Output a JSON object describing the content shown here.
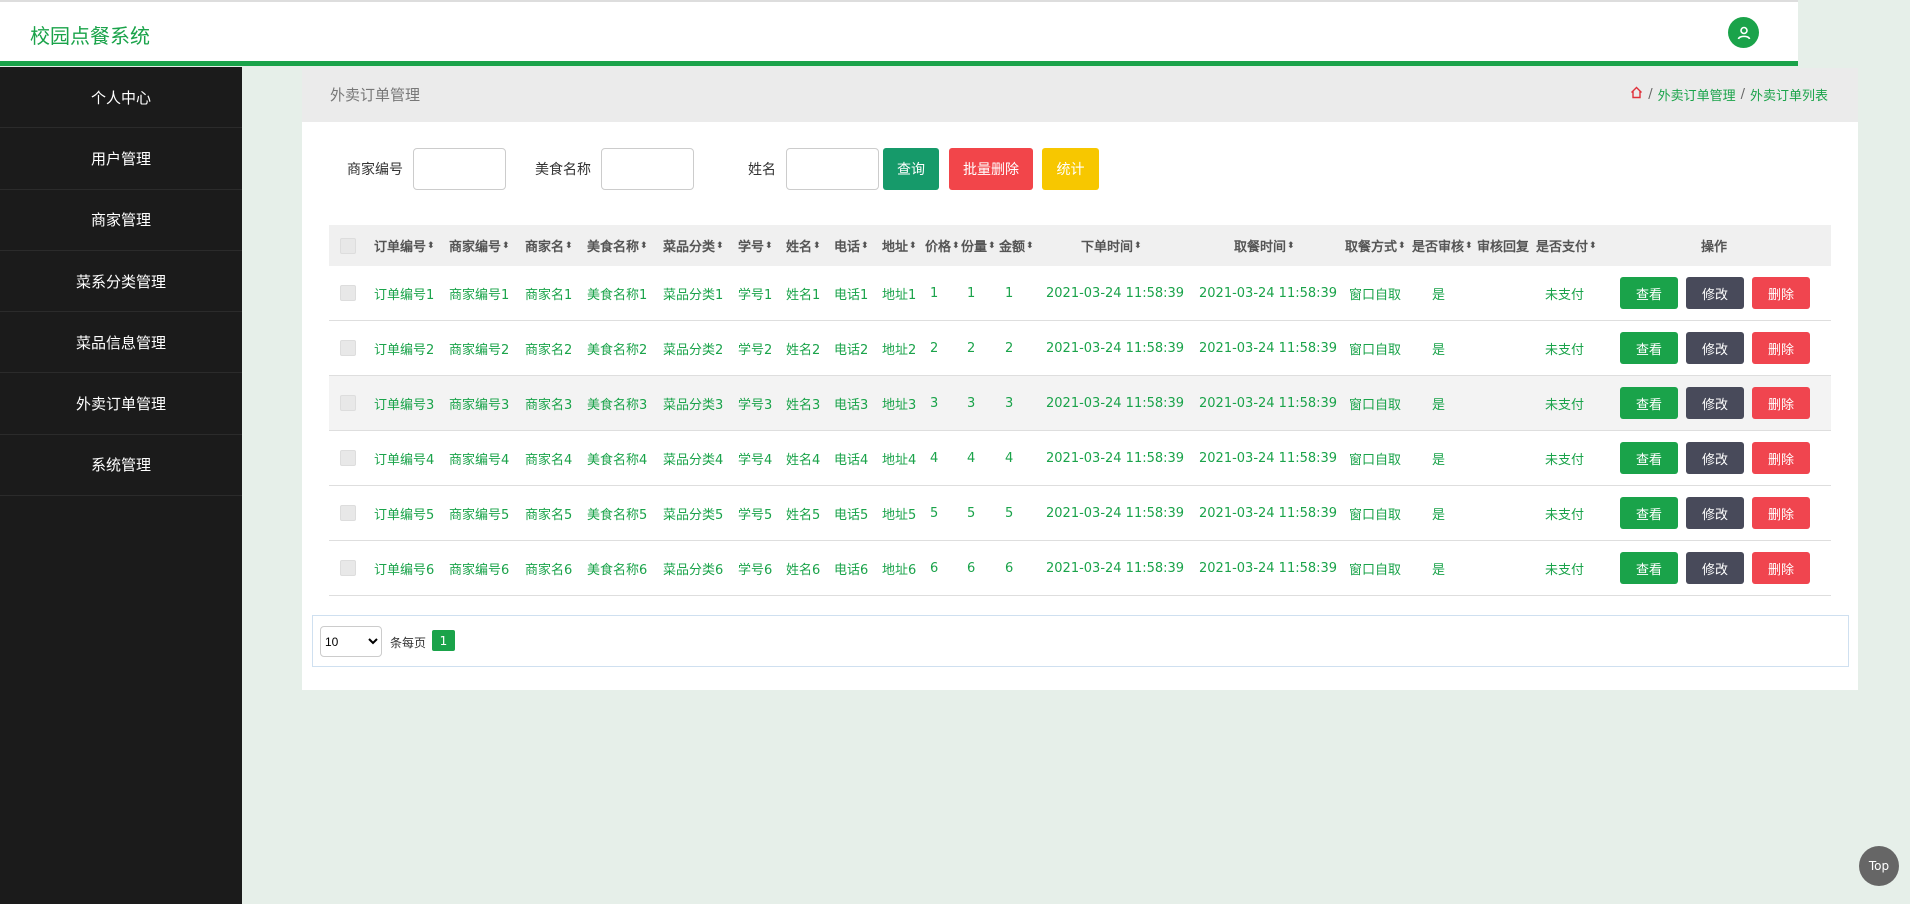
{
  "app": {
    "title": "校园点餐系统"
  },
  "sidebar": {
    "items": [
      {
        "label": "个人中心"
      },
      {
        "label": "用户管理"
      },
      {
        "label": "商家管理"
      },
      {
        "label": "菜系分类管理"
      },
      {
        "label": "菜品信息管理"
      },
      {
        "label": "外卖订单管理"
      },
      {
        "label": "系统管理"
      }
    ]
  },
  "panel": {
    "title": "外卖订单管理",
    "breadcrumb": [
      "外卖订单管理",
      "外卖订单列表"
    ]
  },
  "search": {
    "merchant_no_label": "商家编号",
    "food_name_label": "美食名称",
    "name_label": "姓名",
    "query_button": "查询",
    "batch_delete_button": "批量删除",
    "stats_button": "统计"
  },
  "table": {
    "headers": [
      "订单编号",
      "商家编号",
      "商家名",
      "美食名称",
      "菜品分类",
      "学号",
      "姓名",
      "电话",
      "地址",
      "价格",
      "份量",
      "金额",
      "下单时间",
      "取餐时间",
      "取餐方式",
      "是否审核",
      "审核回复",
      "是否支付",
      "操作"
    ],
    "rows": [
      [
        "订单编号1",
        "商家编号1",
        "商家名1",
        "美食名称1",
        "菜品分类1",
        "学号1",
        "姓名1",
        "电话1",
        "地址1",
        "1",
        "1",
        "1",
        "2021-03-24 11:58:39",
        "2021-03-24 11:58:39",
        "窗口自取",
        "是",
        "",
        "未支付"
      ],
      [
        "订单编号2",
        "商家编号2",
        "商家名2",
        "美食名称2",
        "菜品分类2",
        "学号2",
        "姓名2",
        "电话2",
        "地址2",
        "2",
        "2",
        "2",
        "2021-03-24 11:58:39",
        "2021-03-24 11:58:39",
        "窗口自取",
        "是",
        "",
        "未支付"
      ],
      [
        "订单编号3",
        "商家编号3",
        "商家名3",
        "美食名称3",
        "菜品分类3",
        "学号3",
        "姓名3",
        "电话3",
        "地址3",
        "3",
        "3",
        "3",
        "2021-03-24 11:58:39",
        "2021-03-24 11:58:39",
        "窗口自取",
        "是",
        "",
        "未支付"
      ],
      [
        "订单编号4",
        "商家编号4",
        "商家名4",
        "美食名称4",
        "菜品分类4",
        "学号4",
        "姓名4",
        "电话4",
        "地址4",
        "4",
        "4",
        "4",
        "2021-03-24 11:58:39",
        "2021-03-24 11:58:39",
        "窗口自取",
        "是",
        "",
        "未支付"
      ],
      [
        "订单编号5",
        "商家编号5",
        "商家名5",
        "美食名称5",
        "菜品分类5",
        "学号5",
        "姓名5",
        "电话5",
        "地址5",
        "5",
        "5",
        "5",
        "2021-03-24 11:58:39",
        "2021-03-24 11:58:39",
        "窗口自取",
        "是",
        "",
        "未支付"
      ],
      [
        "订单编号6",
        "商家编号6",
        "商家名6",
        "美食名称6",
        "菜品分类6",
        "学号6",
        "姓名6",
        "电话6",
        "地址6",
        "6",
        "6",
        "6",
        "2021-03-24 11:58:39",
        "2021-03-24 11:58:39",
        "窗口自取",
        "是",
        "",
        "未支付"
      ]
    ],
    "actions": {
      "view": "查看",
      "edit": "修改",
      "delete": "删除"
    }
  },
  "pager": {
    "page_size": "10",
    "per_page_label": "条每页",
    "current_page": "1"
  },
  "back_to_top": "Top",
  "colors": {
    "accent": "#1aa34a",
    "sidebar_bg": "#1b1b1b",
    "danger": "#f0454f",
    "warning": "#f7c700",
    "query": "#169a6a"
  },
  "icons": {
    "user": "user-icon",
    "home": "home-icon",
    "sort": "sort-icon"
  }
}
